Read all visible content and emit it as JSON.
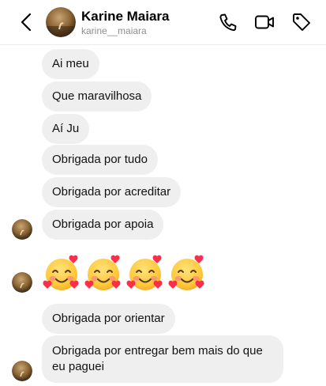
{
  "header": {
    "name": "Karine Maiara",
    "username": "karine__maiara"
  },
  "messages": [
    {
      "text": "Ai meu"
    },
    {
      "text": "Que maravilhosa"
    },
    {
      "text": "Aí Ju"
    },
    {
      "text": "Obrigada por tudo"
    },
    {
      "text": "Obrigada por acreditar"
    },
    {
      "text": "Obrigada por apoia"
    },
    {
      "emoji": "smiling-face-with-hearts",
      "count": 4
    },
    {
      "text": "Obrigada por orientar"
    },
    {
      "text": "Obrigada por entregar bem mais do que eu paguei"
    }
  ],
  "icons": {
    "back": "chevron-left-icon",
    "call": "phone-icon",
    "video": "video-camera-icon",
    "tag": "tag-icon"
  },
  "colors": {
    "bubble": "#efefef",
    "secondary_text": "#8e8e8e"
  }
}
